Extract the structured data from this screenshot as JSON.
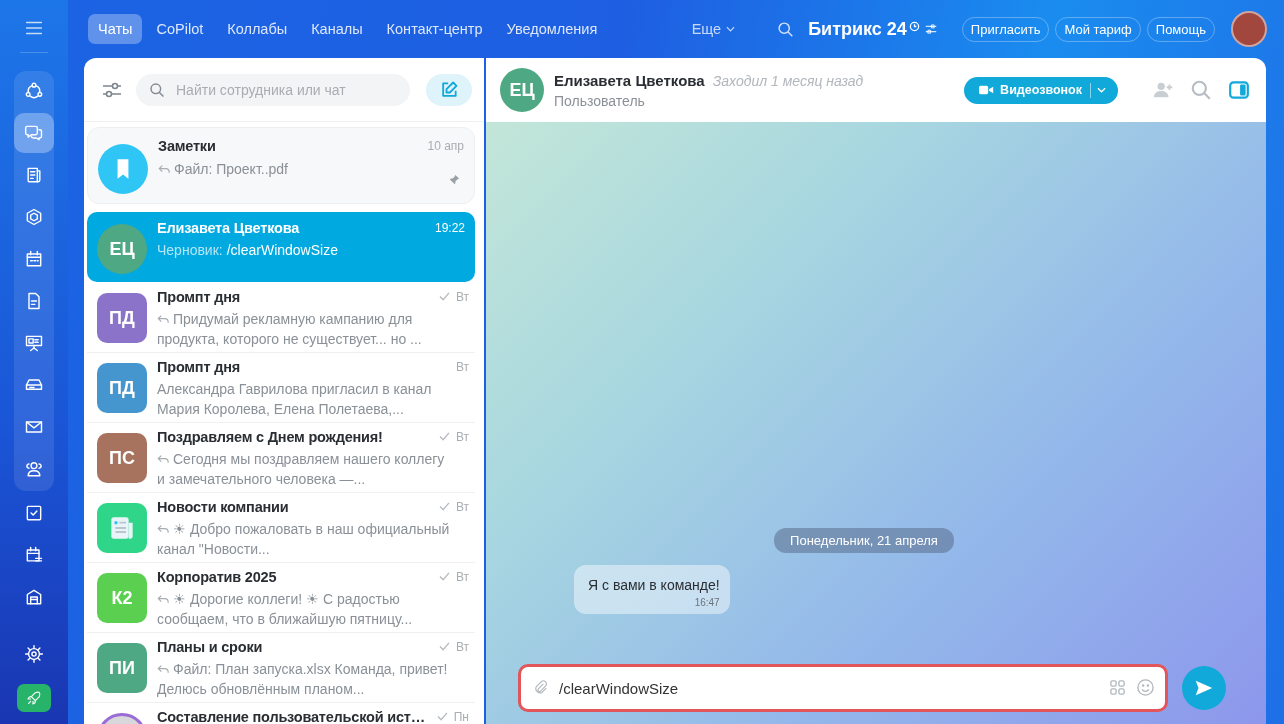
{
  "rail": {
    "panel_items": [
      {
        "kind": "nodes",
        "selected": false
      },
      {
        "kind": "chat-bubbles",
        "selected": true
      },
      {
        "kind": "newspaper",
        "selected": false
      },
      {
        "kind": "hexagon",
        "selected": false
      },
      {
        "kind": "calendar",
        "selected": false
      },
      {
        "kind": "file",
        "selected": false
      },
      {
        "kind": "presentation",
        "selected": false
      },
      {
        "kind": "drive",
        "selected": false
      },
      {
        "kind": "mail",
        "selected": false
      },
      {
        "kind": "people",
        "selected": false
      }
    ],
    "items": [
      {
        "kind": "task",
        "selected": false
      },
      {
        "kind": "calendar-list",
        "selected": false
      },
      {
        "kind": "warehouse",
        "selected": false
      }
    ],
    "bottom": [
      {
        "kind": "gear"
      },
      {
        "kind": "rocket"
      }
    ]
  },
  "nav": {
    "tabs": [
      {
        "label": "Чаты",
        "selected": true
      },
      {
        "label": "CoPilot",
        "selected": false
      },
      {
        "label": "Коллабы",
        "selected": false
      },
      {
        "label": "Каналы",
        "selected": false
      },
      {
        "label": "Контакт-центр",
        "selected": false
      },
      {
        "label": "Уведомления",
        "selected": false
      }
    ],
    "more": "Еще"
  },
  "logo": {
    "name": "Битрикс",
    "number": "24"
  },
  "header_buttons": [
    "Пригласить",
    "Мой тариф",
    "Помощь"
  ],
  "chat_list": {
    "search": {
      "placeholder": "Найти сотрудника или чат"
    },
    "items": [
      {
        "title": "Заметки",
        "time": "10 апр",
        "avatar": {
          "kind": "notes",
          "color": "#2fc6f6"
        },
        "reply": true,
        "preview": "Файл: Проект..pdf",
        "read": false,
        "pinned": true,
        "selected": false
      },
      {
        "title": "Елизавета Цветкова",
        "time": "19:22",
        "avatar": {
          "kind": "user",
          "initials": "ЕЦ",
          "color": "#4ea883"
        },
        "reply": false,
        "draft_label": "Черновик:",
        "preview": "/clearWindowSize",
        "read": false,
        "pinned": false,
        "selected": true
      },
      {
        "title": "Промпт дня",
        "time": "Вт",
        "avatar": {
          "kind": "group",
          "initials": "ПД",
          "color": "#8a73c9"
        },
        "reply": true,
        "preview": "Придумай рекламную кампанию для продукта, которого не существует... но ...",
        "read": true,
        "pinned": false,
        "selected": false
      },
      {
        "title": "Промпт дня",
        "time": "Вт",
        "avatar": {
          "kind": "group",
          "initials": "ПД",
          "color": "#4596cf"
        },
        "reply": false,
        "preview": "Александра Гаврилова пригласил в канал Мария Королева, Елена Полетаева,...",
        "read": false,
        "pinned": false,
        "selected": false
      },
      {
        "title": "Поздравляем с Днем рождения!",
        "time": "Вт",
        "avatar": {
          "kind": "group",
          "initials": "ПС",
          "color": "#a8735e"
        },
        "reply": true,
        "preview": "Сегодня мы поздравляем нашего коллегу и замечательного человека —...",
        "read": true,
        "pinned": false,
        "selected": false
      },
      {
        "title": "Новости компании",
        "time": "Вт",
        "avatar": {
          "kind": "news",
          "color": "#2fd68a"
        },
        "reply": true,
        "preview": "☀ Добро пожаловать в наш официальный канал \"Новости...",
        "read": true,
        "pinned": false,
        "selected": false
      },
      {
        "title": "Корпоратив 2025",
        "time": "Вт",
        "avatar": {
          "kind": "group",
          "initials": "К2",
          "color": "#5bcf4f"
        },
        "reply": true,
        "preview": "☀ Дорогие коллеги! ☀ С радостью сообщаем, что в ближайшую пятницу...",
        "read": true,
        "pinned": false,
        "selected": false
      },
      {
        "title": "Планы и сроки",
        "time": "Вт",
        "avatar": {
          "kind": "group",
          "initials": "ПИ",
          "color": "#4ea883"
        },
        "reply": true,
        "preview": "Файл: План запуска.xlsx Команда, привет! Делюсь обновлённым планом...",
        "read": true,
        "pinned": false,
        "selected": false
      },
      {
        "title": "Составление пользовательской ист…",
        "time": "Пн",
        "avatar": {
          "kind": "photo",
          "color": "#9b6bd6"
        },
        "reply": false,
        "read": true,
        "pinned": false,
        "selected": false
      }
    ]
  },
  "chat": {
    "initials": "ЕЦ",
    "name": "Елизавета Цветкова",
    "status": "Заходил 1 месяц назад",
    "role": "Пользователь",
    "call_button": "Видеозвонок",
    "date_divider": "Понедельник, 21 апреля",
    "messages": [
      {
        "text": "Я с вами в команде!",
        "time": "16:47"
      }
    ],
    "composer": {
      "value": "/clearWindowSize"
    }
  }
}
